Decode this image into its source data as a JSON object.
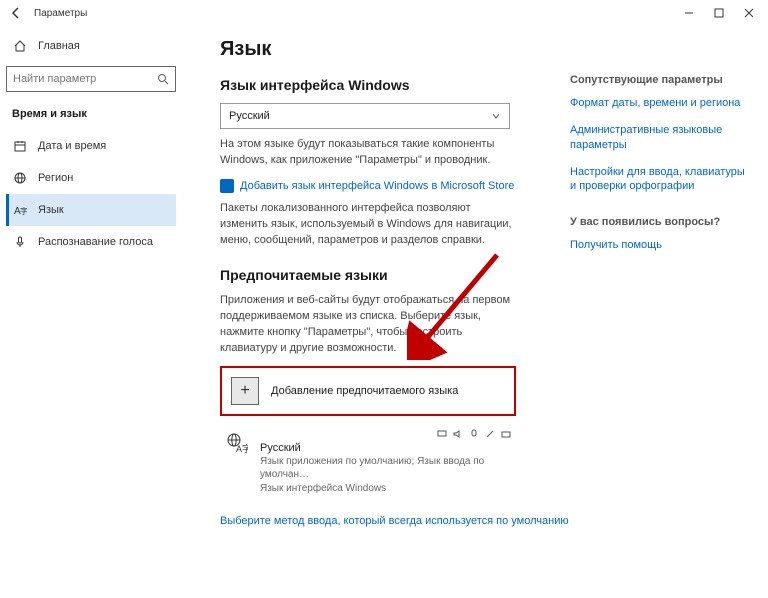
{
  "title_bar": {
    "title": "Параметры"
  },
  "sidebar": {
    "home": "Главная",
    "search_placeholder": "Найти параметр",
    "category": "Время и язык",
    "items": [
      {
        "label": "Дата и время"
      },
      {
        "label": "Регион"
      },
      {
        "label": "Язык"
      },
      {
        "label": "Распознавание голоса"
      }
    ]
  },
  "page": {
    "title": "Язык",
    "section_display": "Язык интерфейса Windows",
    "display_selected": "Русский",
    "display_desc": "На этом языке будут показываться такие компоненты Windows, как приложение \"Параметры\" и проводник.",
    "store_link": "Добавить язык интерфейса Windows в Microsoft Store",
    "packs_desc": "Пакеты локализованного интерфейса позволяют изменить язык, используемый в Windows для навигации, меню, сообщений, параметров и разделов справки.",
    "section_preferred": "Предпочитаемые языки",
    "preferred_desc": "Приложения и веб-сайты будут отображаться на первом поддерживаемом языке из списка. Выберите язык, нажмите кнопку \"Параметры\", чтобы настроить клавиатуру и другие возможности.",
    "add_language": "Добавление предпочитаемого языка",
    "lang_entry": {
      "name": "Русский",
      "line1": "Язык приложения по умолчанию; Язык ввода по умолчан…",
      "line2": "Язык интерфейса Windows"
    },
    "default_ime_link": "Выберите метод ввода, который всегда используется по умолчанию"
  },
  "right": {
    "related_head": "Сопутствующие параметры",
    "link1": "Формат даты, времени и региона",
    "link2": "Административные языковые параметры",
    "link3": "Настройки для ввода, клавиатуры и проверки орфографии",
    "question_head": "У вас появились вопросы?",
    "help_link": "Получить помощь"
  }
}
